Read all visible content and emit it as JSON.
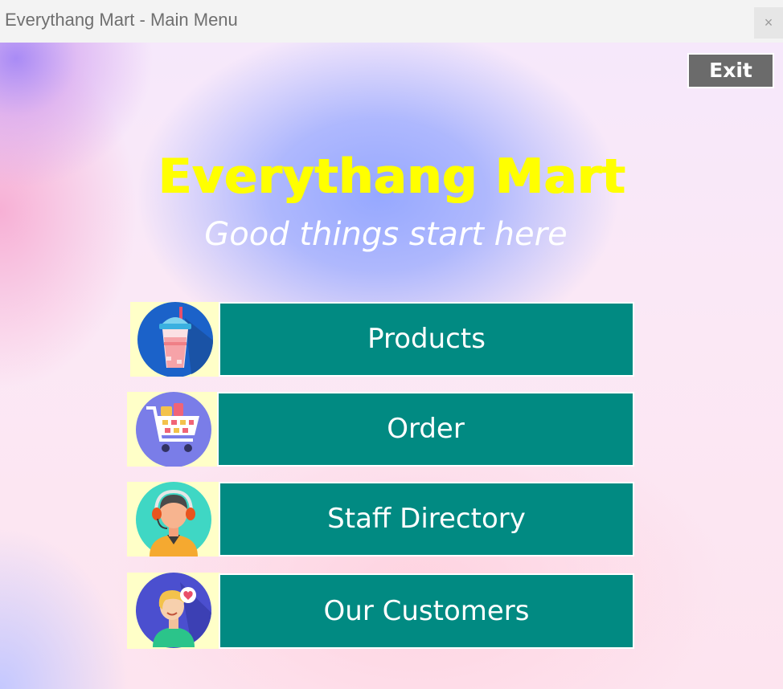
{
  "window": {
    "title": "Everythang Mart - Main Menu",
    "close_glyph": "×"
  },
  "header": {
    "exit_label": "Exit",
    "brand": "Everythang Mart",
    "tagline": "Good things start here"
  },
  "menu": {
    "items": [
      {
        "label": "Products",
        "icon": "bubble-tea-icon"
      },
      {
        "label": "Order",
        "icon": "shopping-cart-icon"
      },
      {
        "label": "Staff Directory",
        "icon": "support-agent-icon"
      },
      {
        "label": "Our Customers",
        "icon": "customer-heart-icon"
      }
    ]
  },
  "colors": {
    "button_bg": "#018a82",
    "icon_box_bg": "#ffffc8",
    "brand_text": "#ffff00",
    "exit_bg": "#6b6b6b"
  }
}
